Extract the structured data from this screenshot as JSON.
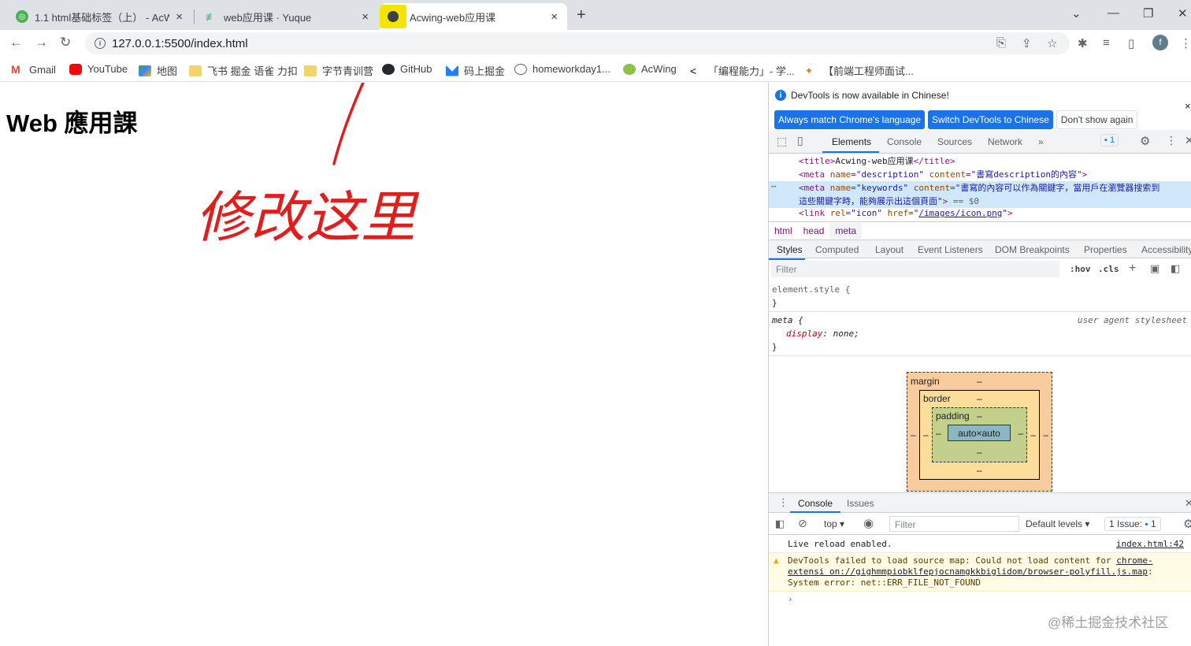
{
  "tabs": [
    {
      "title": "1.1 html基础标签（上） - AcWi",
      "close": "×"
    },
    {
      "title": "web应用课 · Yuque",
      "close": "×"
    },
    {
      "title": "Acwing-web应用课",
      "close": "×"
    }
  ],
  "address": "127.0.0.1:5500/index.html",
  "profile_initial": "f",
  "bookmarks": [
    "Gmail",
    "YouTube",
    "地图",
    "飞书 掘金 语雀 力扣",
    "字节青训营",
    "GitHub",
    "码上掘金",
    "homeworkday1...",
    "AcWing",
    "「编程能力」- 学...",
    "【前端工程师面试..."
  ],
  "page": {
    "heading": "Web 應用課",
    "annotation": "修改这里"
  },
  "devtools": {
    "info": "DevTools is now available in Chinese!",
    "btn_match": "Always match Chrome's language",
    "btn_switch": "Switch DevTools to Chinese",
    "btn_dont": "Don't show again",
    "tabs": [
      "Elements",
      "Console",
      "Sources",
      "Network"
    ],
    "more": "»",
    "issues_badge": "1",
    "dom": {
      "title_text": "Acwing-web应用课",
      "desc_content": "\"書寫description的內容\"",
      "kw_content_1": "\"書寫的內容可以作為關鍵字，當用戶在瀏覽器搜索到",
      "kw_content_2": "這些關鍵字時，能夠展示出這個頁面\"",
      "eq": "== $0",
      "icon_href": "/images/icon.png",
      "dots": "⋯"
    },
    "crumbs": [
      "html",
      "head",
      "meta"
    ],
    "subtabs": [
      "Styles",
      "Computed",
      "Layout",
      "Event Listeners",
      "DOM Breakpoints",
      "Properties",
      "Accessibility"
    ],
    "filter": "Filter",
    "hov": ":hov",
    "cls": ".cls",
    "styles": {
      "element_style": "element.style {",
      "close": "}",
      "meta_sel": "meta {",
      "ua": "user agent stylesheet",
      "prop": "display",
      "val": "none"
    },
    "box": {
      "margin": "margin",
      "border": "border",
      "padding": "padding",
      "content": "auto×auto",
      "dash": "–"
    },
    "console": {
      "tabs": [
        "Console",
        "Issues"
      ],
      "context": "top",
      "filter": "Filter",
      "levels": "Default levels",
      "issue": "1 Issue:",
      "issue_count": "1",
      "msg1": "Live reload enabled.",
      "msg1_src": "index.html:42",
      "warn_a": "DevTools failed to load source map: Could not load content for ",
      "warn_link": "chrome-extensi on://gighmmpiobklfepjocnamgkkbiglidom/browser-polyfill.js.map",
      "warn_b": ": System error: net::ERR_FILE_NOT_FOUND",
      "prompt": "›"
    }
  },
  "watermark": "@稀土掘金技术社区"
}
